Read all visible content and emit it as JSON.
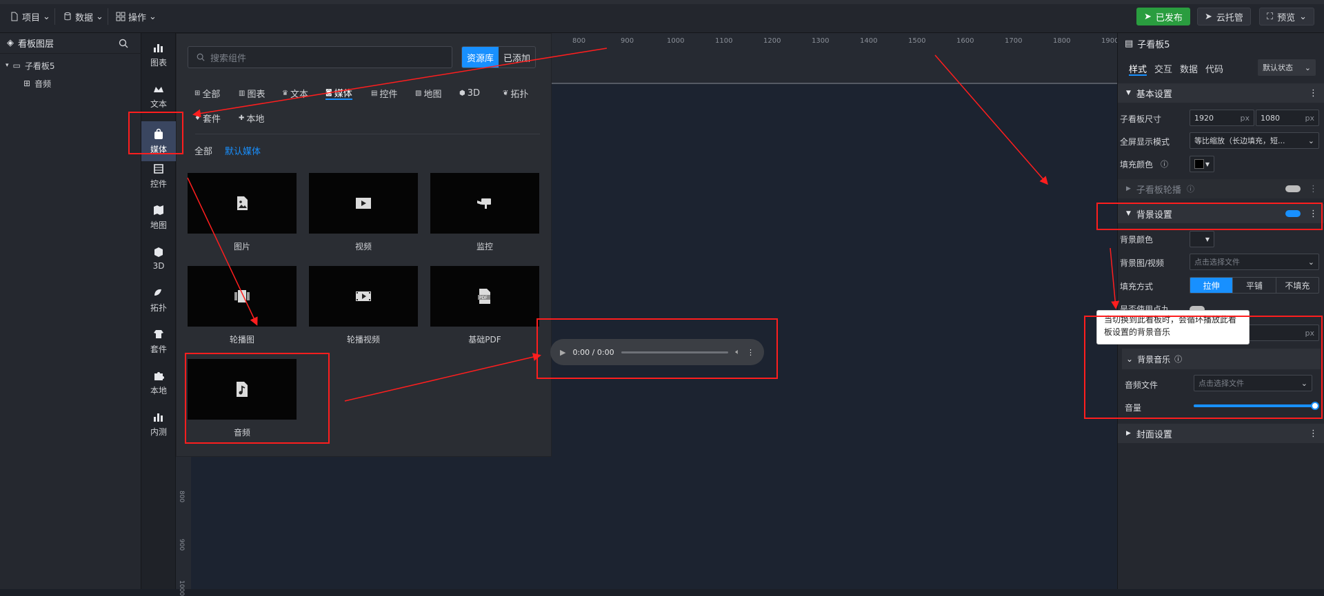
{
  "topbar": {
    "menus": [
      {
        "label": "项目"
      },
      {
        "label": "数据"
      },
      {
        "label": "操作"
      }
    ],
    "buttons": {
      "publish": "已发布",
      "cloud": "云托管",
      "preview": "预览"
    }
  },
  "layers": {
    "title": "看板图层",
    "items": [
      {
        "label": "子看板5"
      },
      {
        "label": "音频"
      }
    ]
  },
  "iconbar": [
    {
      "label": "图表",
      "icon": "chart-icon"
    },
    {
      "label": "文本",
      "icon": "text-icon"
    },
    {
      "label": "媒体",
      "icon": "media-icon"
    },
    {
      "label": "控件",
      "icon": "widget-icon"
    },
    {
      "label": "地图",
      "icon": "map-icon"
    },
    {
      "label": "3D",
      "icon": "cube-icon"
    },
    {
      "label": "拓扑",
      "icon": "topology-icon"
    },
    {
      "label": "套件",
      "icon": "suite-icon"
    },
    {
      "label": "本地",
      "icon": "puzzle-icon"
    },
    {
      "label": "内测",
      "icon": "beta-icon"
    }
  ],
  "ruler": {
    "ticks": [
      "800",
      "900",
      "1000",
      "1100",
      "1200",
      "1300",
      "1400",
      "1500",
      "1600",
      "1700",
      "1800",
      "1900"
    ],
    "vticks": [
      "800",
      "900",
      "1000"
    ]
  },
  "components": {
    "search_placeholder": "搜索组件",
    "segments": [
      "资源库",
      "已添加"
    ],
    "tabs": [
      "全部",
      "图表",
      "文本",
      "媒体",
      "控件",
      "地图",
      "3D",
      "拓扑"
    ],
    "tabs2": [
      "套件",
      "本地"
    ],
    "subtabs": [
      "全部",
      "默认媒体"
    ],
    "cards": [
      {
        "label": "图片",
        "icon": "image-icon"
      },
      {
        "label": "视频",
        "icon": "video-icon"
      },
      {
        "label": "监控",
        "icon": "camera-icon"
      },
      {
        "label": "轮播图",
        "icon": "carousel-icon"
      },
      {
        "label": "轮播视频",
        "icon": "film-icon"
      },
      {
        "label": "基础PDF",
        "icon": "pdf-icon"
      },
      {
        "label": "音频",
        "icon": "music-icon"
      }
    ]
  },
  "player": {
    "time": "0:00 / 0:00"
  },
  "right": {
    "title": "子看板5",
    "tabs": [
      "样式",
      "交互",
      "数据",
      "代码"
    ],
    "state": "默认状态",
    "basic": {
      "title": "基本设置",
      "size_label": "子看板尺寸",
      "width": "1920",
      "height": "1080",
      "unit": "px",
      "fullscreen_label": "全屏显示模式",
      "fullscreen_value": "等比缩放（长边填充，短...",
      "fill_label": "填充颜色"
    },
    "carousel_title": "子看板轮播",
    "bg": {
      "title": "背景设置",
      "color_label": "背景颜色",
      "media_label": "背景图/视频",
      "media_placeholder": "点击选择文件",
      "fill_label": "填充方式",
      "fill_options": [
        "拉伸",
        "平铺",
        "不填充"
      ],
      "dot_label": "是否使用点九",
      "unit": "px"
    },
    "music": {
      "title": "背景音乐",
      "file_label": "音频文件",
      "file_placeholder": "点击选择文件",
      "volume_label": "音量",
      "volume": 1.0
    },
    "cover_title": "封面设置",
    "tooltip": "当切换到此看板时，会循环播放此看板设置的背景音乐"
  },
  "colors": {
    "accent": "#1890ff",
    "publish": "#2a9d3f",
    "annotation": "#ff1e1e"
  }
}
